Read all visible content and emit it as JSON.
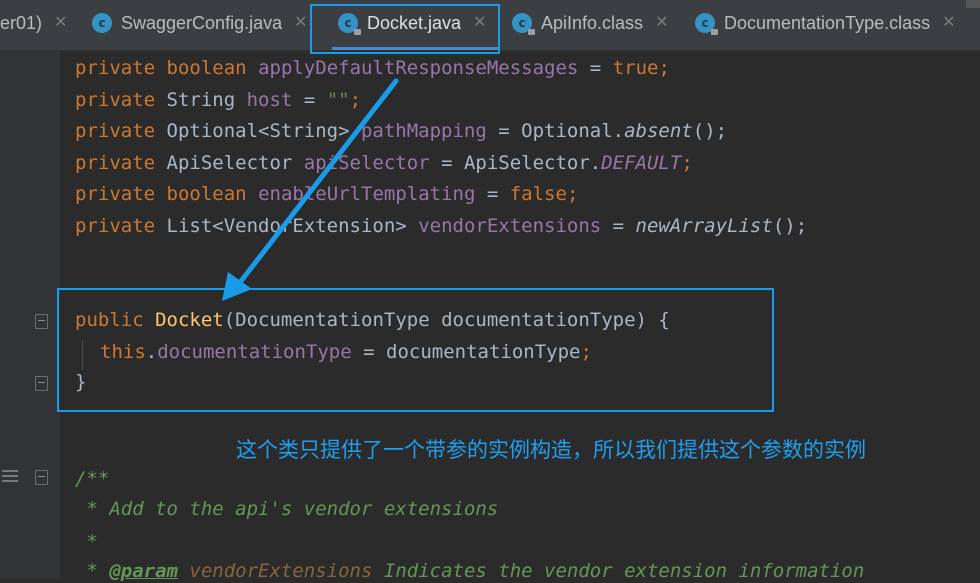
{
  "tabs": [
    {
      "label": "er01)",
      "icon": "none",
      "close": "✕",
      "active": false
    },
    {
      "label": "SwaggerConfig.java",
      "icon": "java-class-icon",
      "close": "✕",
      "active": false
    },
    {
      "label": "Docket.java",
      "icon": "java-class-locked-icon",
      "close": "✕",
      "active": true
    },
    {
      "label": "ApiInfo.class",
      "icon": "java-class-locked-icon",
      "close": "✕",
      "active": false
    },
    {
      "label": "DocumentationType.class",
      "icon": "java-class-locked-icon",
      "close": "✕",
      "active": false
    }
  ],
  "code": {
    "l1": {
      "kw1": "private",
      "kw2": "boolean",
      "name": "applyDefaultResponseMessages",
      "eq": " = ",
      "val": "true",
      "end": ";"
    },
    "l2": {
      "kw1": "private",
      "type": " String ",
      "name": "host",
      "eq": " = ",
      "val": "\"\"",
      "end": ";"
    },
    "l3": {
      "kw1": "private",
      "type": " Optional<String> ",
      "name": "pathMapping",
      "eq": " = Optional.",
      "call": "absent",
      "end": "();"
    },
    "l4": {
      "kw1": "private",
      "type": " ApiSelector ",
      "name": "apiSelector",
      "eq": " = ApiSelector.",
      "const": "DEFAULT",
      "end": ";"
    },
    "l5": {
      "kw1": "private",
      "kw2": "boolean",
      "name": "enableUrlTemplating",
      "eq": " = ",
      "val": "false",
      "end": ";"
    },
    "l6": {
      "kw1": "private",
      "type": " List<VendorExtension> ",
      "name": "vendorExtensions",
      "eq": " = ",
      "call": "newArrayList",
      "end": "();"
    },
    "l7": {
      "kw": "public",
      "name": "Docket",
      "params": "(DocumentationType documentationType) {"
    },
    "l8": {
      "kw": "this",
      "dot": ".",
      "field": "documentationType",
      "rest": " = documentationType",
      "end": ";"
    },
    "l9": {
      "text": "}"
    },
    "c1": {
      "text": "/**"
    },
    "c2": {
      "text": " * Add to the api's vendor extensions"
    },
    "c3": {
      "text": " *"
    },
    "c4": {
      "prefix": " * ",
      "tag": "@param",
      "param": " vendorExtensions",
      "rest": " Indicates the vendor extension information"
    }
  },
  "annotation": "这个类只提供了一个带参的实例构造，所以我们提供这个参数的实例",
  "colors": {
    "highlight": "#1a9bea",
    "arrow": "#1a9bea",
    "annotation_text": "#1e9ff2"
  }
}
